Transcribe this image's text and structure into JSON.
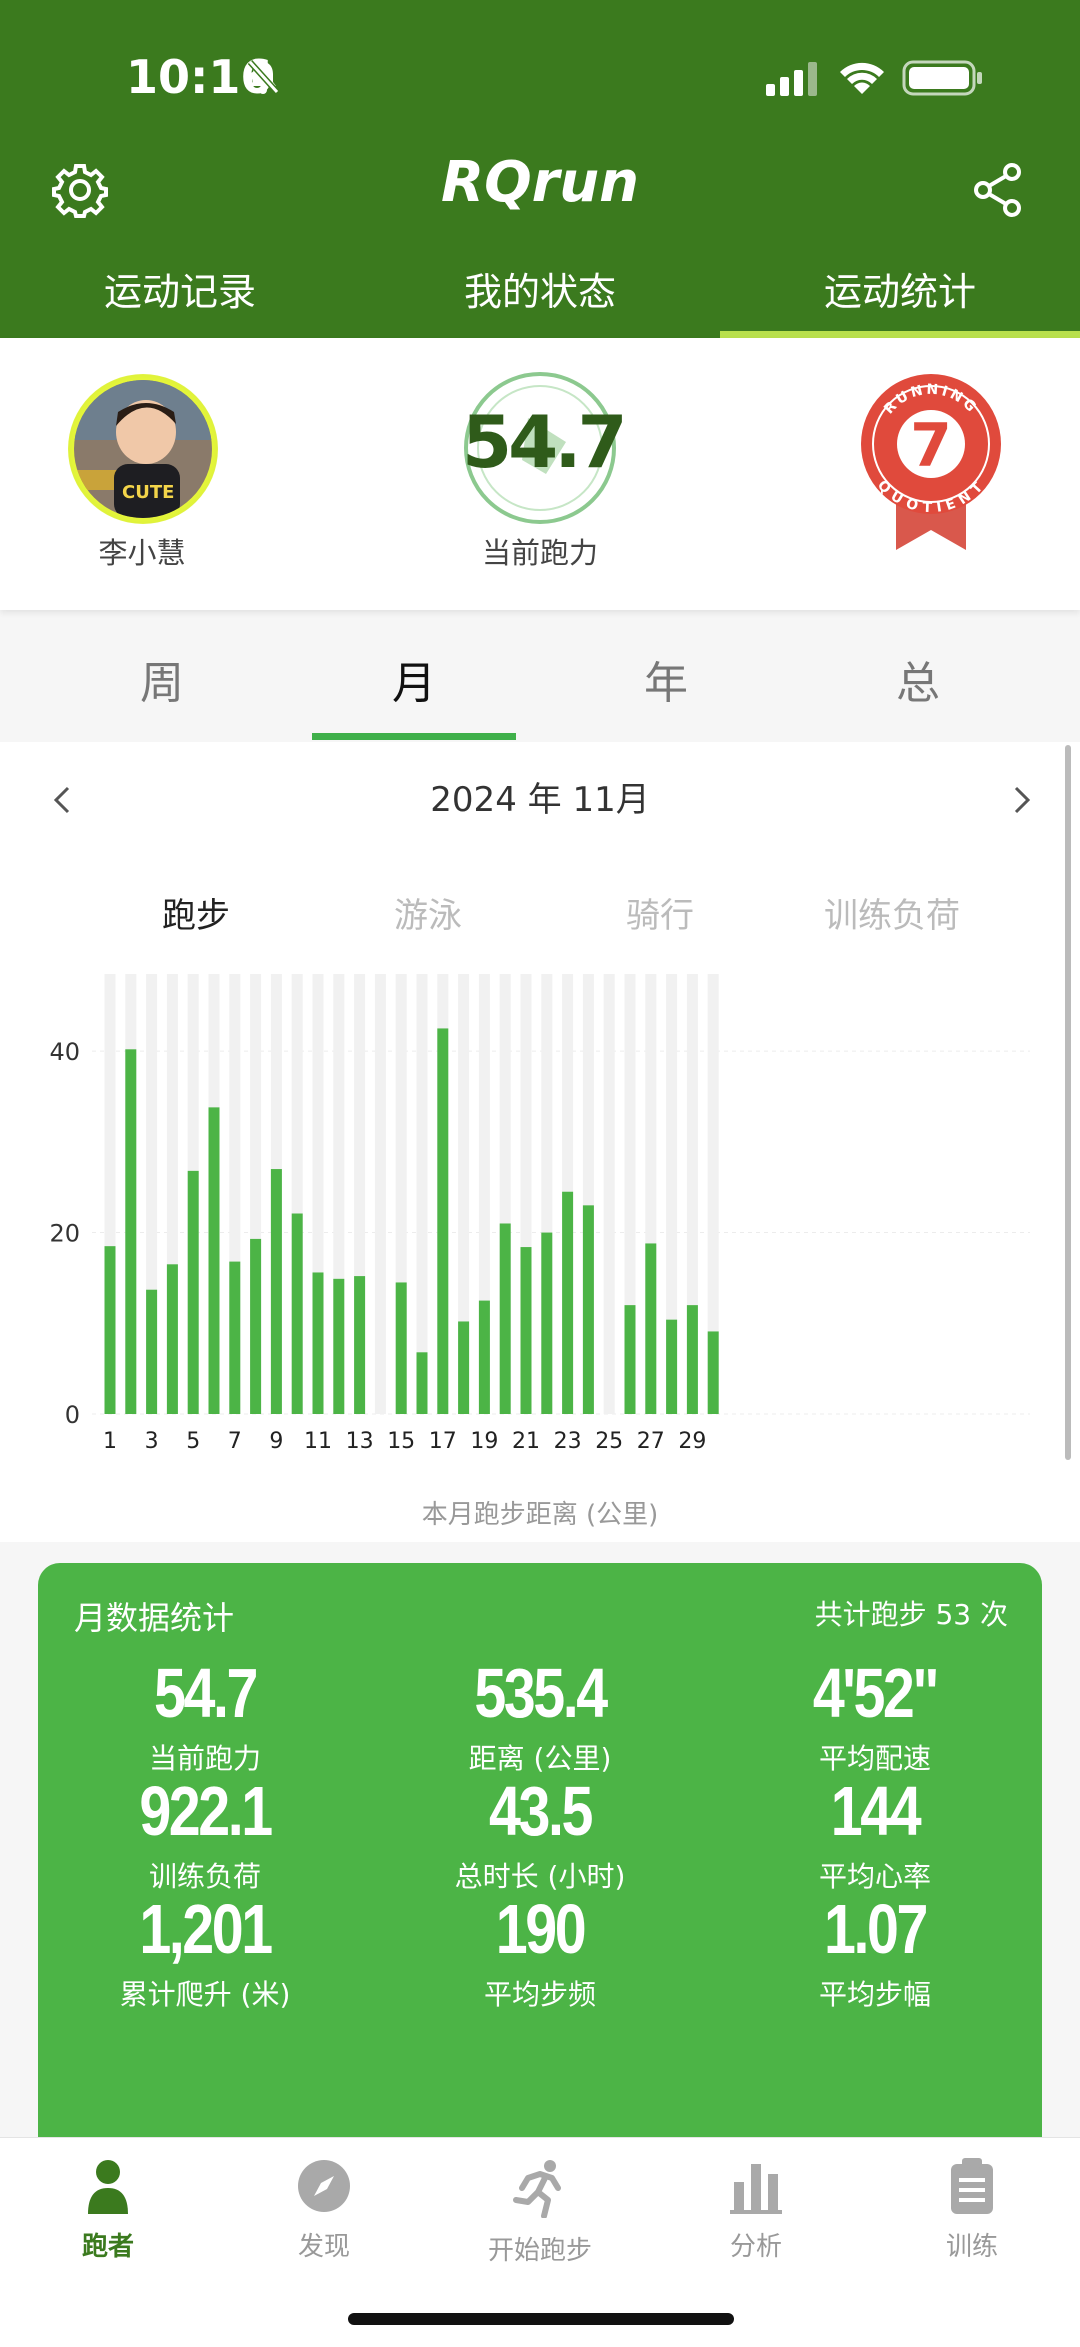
{
  "status_bar": {
    "time": "10:16"
  },
  "app": {
    "title": "RQrun"
  },
  "top_tabs": [
    {
      "label": "运动记录",
      "active": false
    },
    {
      "label": "我的状态",
      "active": false
    },
    {
      "label": "运动统计",
      "active": true
    }
  ],
  "profile": {
    "name": "李小慧",
    "ability_value": "54.7",
    "ability_label": "当前跑力",
    "badge": {
      "top_text": "RUNNING",
      "bottom_text": "QUOTIENT",
      "number": "7"
    }
  },
  "period_tabs": [
    {
      "label": "周",
      "active": false
    },
    {
      "label": "月",
      "active": true
    },
    {
      "label": "年",
      "active": false
    },
    {
      "label": "总",
      "active": false
    }
  ],
  "month_nav": {
    "label": "2024 年 11月"
  },
  "sport_tabs": [
    {
      "label": "跑步",
      "active": true
    },
    {
      "label": "游泳",
      "active": false
    },
    {
      "label": "骑行",
      "active": false
    },
    {
      "label": "训练负荷",
      "active": false
    }
  ],
  "chart_data": {
    "type": "bar",
    "categories": [
      "1",
      "2",
      "3",
      "4",
      "5",
      "6",
      "7",
      "8",
      "9",
      "10",
      "11",
      "12",
      "13",
      "14",
      "15",
      "16",
      "17",
      "18",
      "19",
      "20",
      "21",
      "22",
      "23",
      "24",
      "25",
      "26",
      "27",
      "28",
      "29",
      "30"
    ],
    "values": [
      18.5,
      40.2,
      13.7,
      16.5,
      26.8,
      33.8,
      16.8,
      19.3,
      27.0,
      22.1,
      15.6,
      14.9,
      15.2,
      0,
      14.5,
      6.8,
      42.5,
      10.2,
      12.5,
      21.0,
      18.4,
      20.0,
      24.5,
      23.0,
      0,
      12.0,
      18.8,
      10.4,
      12.0,
      9.1
    ],
    "ylim": [
      0,
      48.5
    ],
    "y_ticks": [
      "0",
      "20",
      "40"
    ],
    "x_tick_labels": [
      "1",
      "3",
      "5",
      "7",
      "9",
      "11",
      "13",
      "15",
      "17",
      "19",
      "21",
      "23",
      "25",
      "27",
      "29"
    ],
    "xlabel": "本月跑步距离 (公里)",
    "bar_color": "#4cb446",
    "background_bar_color": "#f1f1f1"
  },
  "stats": {
    "title": "月数据统计",
    "total": "共计跑步 53 次",
    "items": [
      {
        "value": "54.7",
        "label": "当前跑力"
      },
      {
        "value": "535.4",
        "label": "距离 (公里)"
      },
      {
        "value": "4'52\"",
        "label": "平均配速"
      },
      {
        "value": "922.1",
        "label": "训练负荷"
      },
      {
        "value": "43.5",
        "label": "总时长 (小时)"
      },
      {
        "value": "144",
        "label": "平均心率"
      },
      {
        "value": "1,201",
        "label": "累计爬升 (米)"
      },
      {
        "value": "190",
        "label": "平均步频"
      },
      {
        "value": "1.07",
        "label": "平均步幅"
      }
    ]
  },
  "bottom_nav": [
    {
      "label": "跑者",
      "icon": "runner-person-icon",
      "active": true
    },
    {
      "label": "发现",
      "icon": "compass-icon",
      "active": false
    },
    {
      "label": "开始跑步",
      "icon": "running-man-icon",
      "active": false
    },
    {
      "label": "分析",
      "icon": "bar-chart-icon",
      "active": false
    },
    {
      "label": "训练",
      "icon": "clipboard-icon",
      "active": false
    }
  ],
  "colors": {
    "header": "#3b7a1e",
    "accent": "#4cb446",
    "tab_indicator": "#b8e04c",
    "badge_red": "#e04a3c"
  }
}
